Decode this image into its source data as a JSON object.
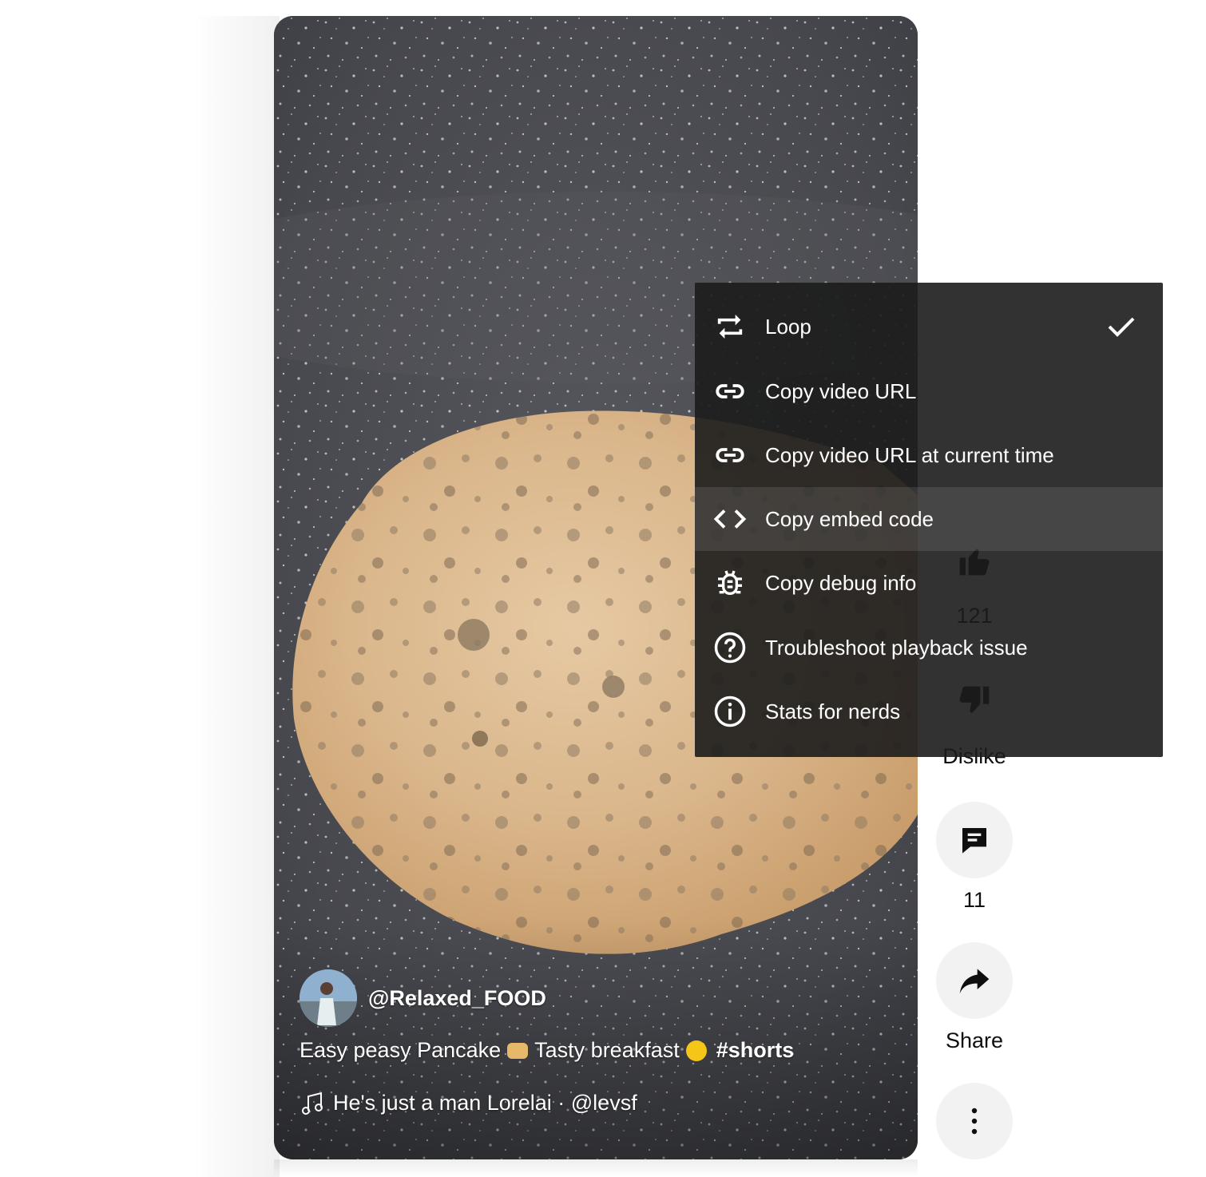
{
  "video": {
    "channel_handle": "@Relaxed_FOOD",
    "title_part1": "Easy peasy Pancake",
    "title_part2": "Tasty breakfast",
    "hashtag": "#shorts",
    "music": "He's just a man Lorelai · @levsf"
  },
  "actions": {
    "like_count": "121",
    "dislike_label": "Dislike",
    "comment_count": "11",
    "share_label": "Share"
  },
  "menu": {
    "items": [
      {
        "label": "Loop",
        "icon": "loop-icon",
        "checked": true
      },
      {
        "label": "Copy video URL",
        "icon": "link-icon"
      },
      {
        "label": "Copy video URL at current time",
        "icon": "link-icon"
      },
      {
        "label": "Copy embed code",
        "icon": "code-icon",
        "highlighted": true
      },
      {
        "label": "Copy debug info",
        "icon": "bug-icon"
      },
      {
        "label": "Troubleshoot playback issue",
        "icon": "help-circle-icon"
      },
      {
        "label": "Stats for nerds",
        "icon": "info-circle-icon"
      }
    ]
  },
  "colors": {
    "menu_background": "#1c1c1c",
    "action_button_background": "#f2f2f2",
    "pancake": "#d9b48a",
    "pan": "#4b4c52"
  }
}
